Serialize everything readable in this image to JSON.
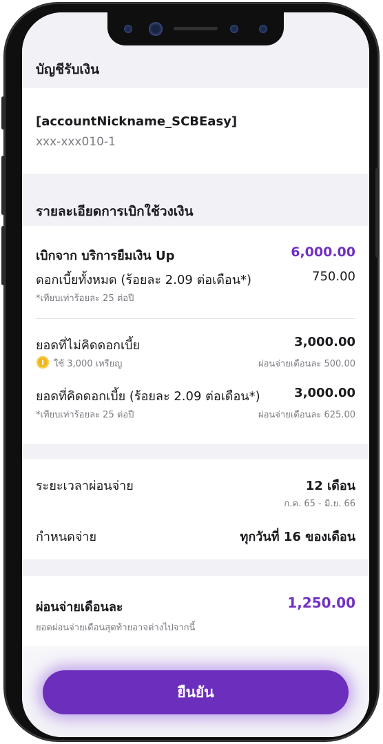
{
  "colors": {
    "accent": "#7131c2",
    "button": "#6c2fbd",
    "background": "#f2f2f6",
    "coin": "#f3b61a"
  },
  "receiving_account": {
    "title": "บัญชีรับเงิน",
    "nickname": "[accountNickname_SCBEasy]",
    "number": "xxx-xxx010-1"
  },
  "withdraw_details": {
    "title": "รายละเอียดการเบิกใช้วงเงิน",
    "withdraw_from_label": "เบิกจาก บริการยืมเงิน Up",
    "withdraw_amount": "6,000.00",
    "total_interest_label": "ดอกเบี้ยทั้งหมด (ร้อยละ 2.09 ต่อเดือน*)",
    "total_interest_amount": "750.00",
    "total_interest_note": "*เทียบเท่าร้อยละ 25 ต่อปี",
    "no_interest_label": "ยอดที่ไม่คิดดอกเบี้ย",
    "no_interest_amount": "3,000.00",
    "coin_icon": "coin-icon",
    "coins_used": "ใช้ 3,000 เหรียญ",
    "no_interest_monthly": "ผ่อนจ่ายเดือนละ 500.00",
    "interest_label": "ยอดที่คิดดอกเบี้ย (ร้อยละ 2.09 ต่อเดือน*)",
    "interest_amount": "3,000.00",
    "interest_note": "*เทียบเท่าร้อยละ 25 ต่อปี",
    "interest_monthly": "ผ่อนจ่ายเดือนละ 625.00"
  },
  "schedule": {
    "period_label": "ระยะเวลาผ่อนจ่าย",
    "period_value": "12 เดือน",
    "period_range": "ก.ค. 65 - มิ.ย. 66",
    "due_label": "กำหนดจ่าย",
    "due_value": "ทุกวันที่ 16 ของเดือน"
  },
  "monthly": {
    "label": "ผ่อนจ่ายเดือนละ",
    "amount": "1,250.00",
    "note": "ยอดผ่อนจ่ายเดือนสุดท้ายอาจต่างไปจากนี้"
  },
  "confirm_button": "ยืนยัน"
}
